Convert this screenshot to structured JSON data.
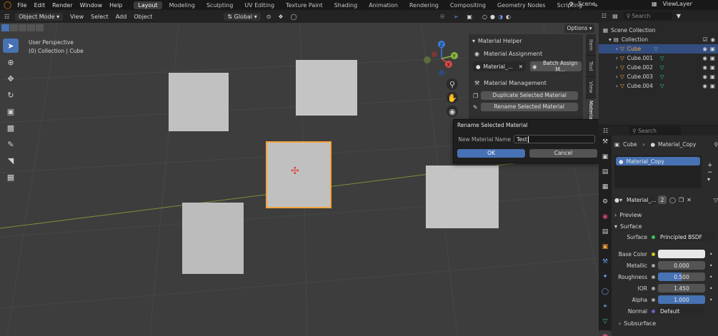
{
  "topbar": {
    "menu": [
      "File",
      "Edit",
      "Render",
      "Window",
      "Help"
    ],
    "workspaces": [
      "Layout",
      "Modeling",
      "Sculpting",
      "UV Editing",
      "Texture Paint",
      "Shading",
      "Animation",
      "Rendering",
      "Compositing",
      "Geometry Nodes",
      "Scripting"
    ],
    "active_workspace": "Layout",
    "scene": "Scene",
    "view_layer": "ViewLayer"
  },
  "viewport_header": {
    "mode": "Object Mode",
    "menus": [
      "View",
      "Select",
      "Add",
      "Object"
    ],
    "transform": "Global",
    "options": "Options"
  },
  "viewport": {
    "perspective": "User Perspective",
    "collection_info": "(0) Collection | Cube"
  },
  "material_helper": {
    "title": "Material Helper",
    "assignment_label": "Material Assignment",
    "material_field": "Material_...",
    "batch_button": "Batch Assign M...",
    "management_label": "Material Management",
    "duplicate_button": "Duplicate Selected Material",
    "rename_button": "Rename Selected Material"
  },
  "npanel_tabs": [
    "Item",
    "Tool",
    "View",
    "Materia"
  ],
  "rename_dialog": {
    "title": "Rename Selected Material",
    "field_label": "New Material Name",
    "field_value": "Test",
    "ok": "OK",
    "cancel": "Cancel"
  },
  "outliner": {
    "search_placeholder": "Search",
    "scene_collection": "Scene Collection",
    "collection": "Collection",
    "items": [
      "Cube",
      "Cube.001",
      "Cube.002",
      "Cube.003",
      "Cube.004"
    ]
  },
  "properties": {
    "search_placeholder": "Search",
    "object": "Cube",
    "material": "Material_Copy",
    "slot": "Material_Copy",
    "data_block": "Material_...",
    "users": "2",
    "preview": "Preview",
    "surface_section": "Surface",
    "surface_label": "Surface",
    "surface_value": "Principled BSDF",
    "fields": [
      {
        "label": "Base Color",
        "value": ""
      },
      {
        "label": "Metallic",
        "value": "0.000"
      },
      {
        "label": "Roughness",
        "value": "0.500"
      },
      {
        "label": "IOR",
        "value": "1.450"
      },
      {
        "label": "Alpha",
        "value": "1.000"
      },
      {
        "label": "Normal",
        "value": "Default"
      }
    ],
    "subsurface": "Subsurface"
  },
  "colors": {
    "accent": "#4772b3",
    "selection_orange": "#f5a33d",
    "axis_x": "#e04a4a",
    "axis_y": "#8ab83a",
    "axis_z": "#3b7de0"
  }
}
